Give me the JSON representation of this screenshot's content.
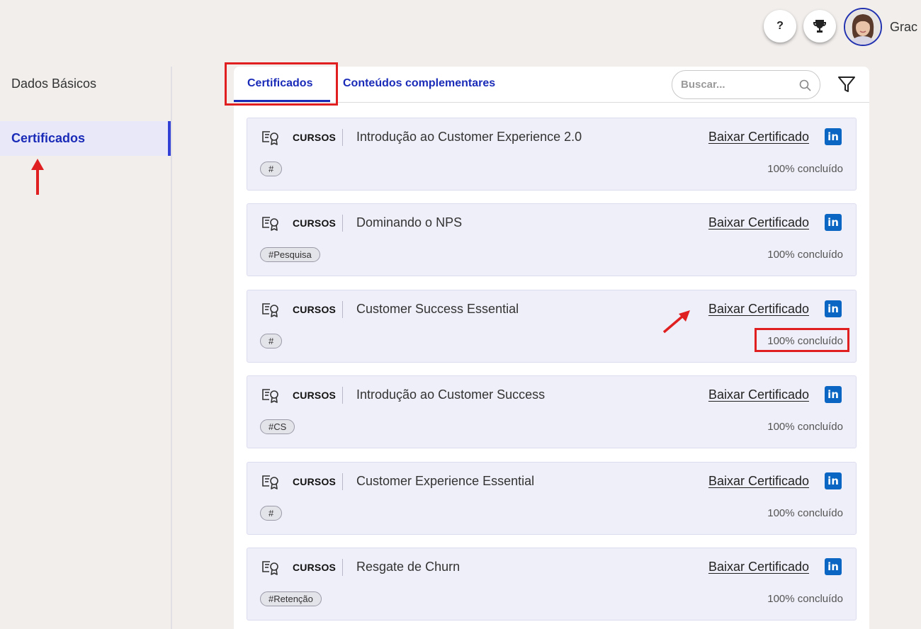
{
  "header": {
    "help_label": "?",
    "user_name": "Grac"
  },
  "sidebar": {
    "items": [
      {
        "label": "Dados Básicos"
      },
      {
        "label": "Certificados"
      }
    ]
  },
  "tabs": [
    {
      "label": "Certificados"
    },
    {
      "label": "Conteúdos complementares"
    }
  ],
  "search": {
    "placeholder": "Buscar..."
  },
  "annotation_color": "#e02020",
  "accent_color": "#1a2bb8",
  "courses": [
    {
      "category": "CURSOS",
      "title": "Introdução ao Customer Experience 2.0",
      "link": "Baixar Certificado",
      "tag": "#",
      "progress": "100% concluído"
    },
    {
      "category": "CURSOS",
      "title": "Dominando o NPS",
      "link": "Baixar Certificado",
      "tag": "#Pesquisa",
      "progress": "100% concluído"
    },
    {
      "category": "CURSOS",
      "title": "Customer Success Essential",
      "link": "Baixar Certificado",
      "tag": "#",
      "progress": "100% concluído"
    },
    {
      "category": "CURSOS",
      "title": "Introdução ao Customer Success",
      "link": "Baixar Certificado",
      "tag": "#CS",
      "progress": "100% concluído"
    },
    {
      "category": "CURSOS",
      "title": "Customer Experience Essential",
      "link": "Baixar Certificado",
      "tag": "#",
      "progress": "100% concluído"
    },
    {
      "category": "CURSOS",
      "title": "Resgate de Churn",
      "link": "Baixar Certificado",
      "tag": "#Retenção",
      "progress": "100% concluído"
    }
  ]
}
